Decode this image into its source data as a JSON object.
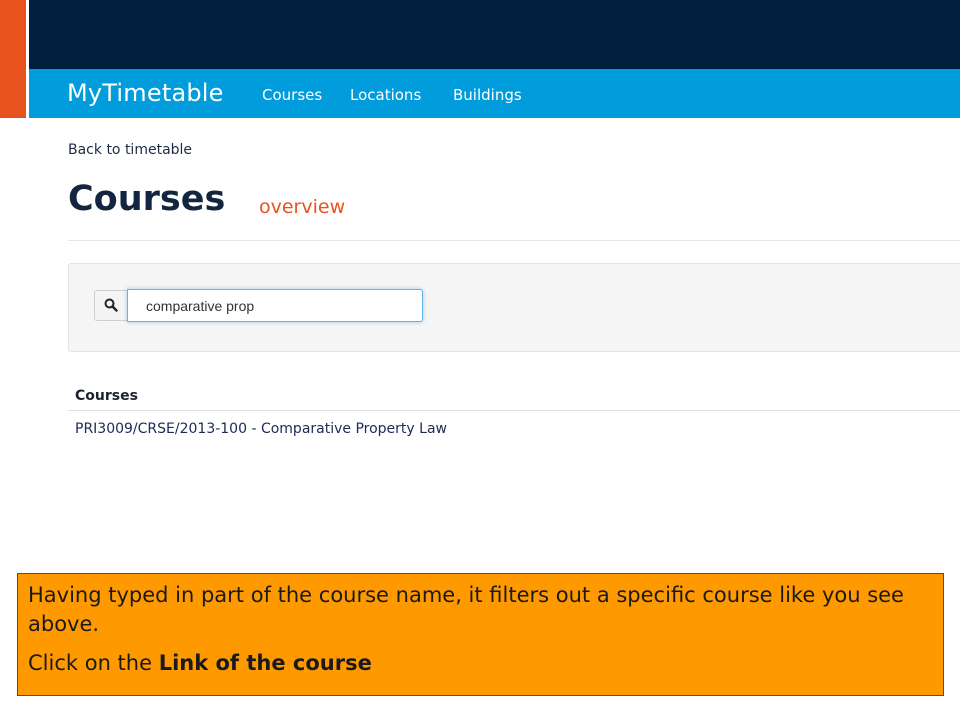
{
  "header": {
    "brand": "MyTimetable",
    "nav": [
      "Courses",
      "Locations",
      "Buildings"
    ]
  },
  "page": {
    "back_link": "Back to timetable",
    "title": "Courses",
    "subtitle": "overview"
  },
  "search": {
    "icon": "search-icon",
    "value": "comparative prop"
  },
  "results": {
    "header": "Courses",
    "items": [
      "PRI3009/CRSE/2013-100 - Comparative Property Law"
    ]
  },
  "callout": {
    "line1": "Having typed in part of the course name, it filters out a specific course like you see above.",
    "line2_prefix": "Click on the ",
    "line2_bold": "Link of the course"
  },
  "colors": {
    "accent_orange": "#e8521c",
    "header_navy": "#001e3d",
    "nav_blue": "#009cdc",
    "callout_bg": "#ff9900"
  }
}
